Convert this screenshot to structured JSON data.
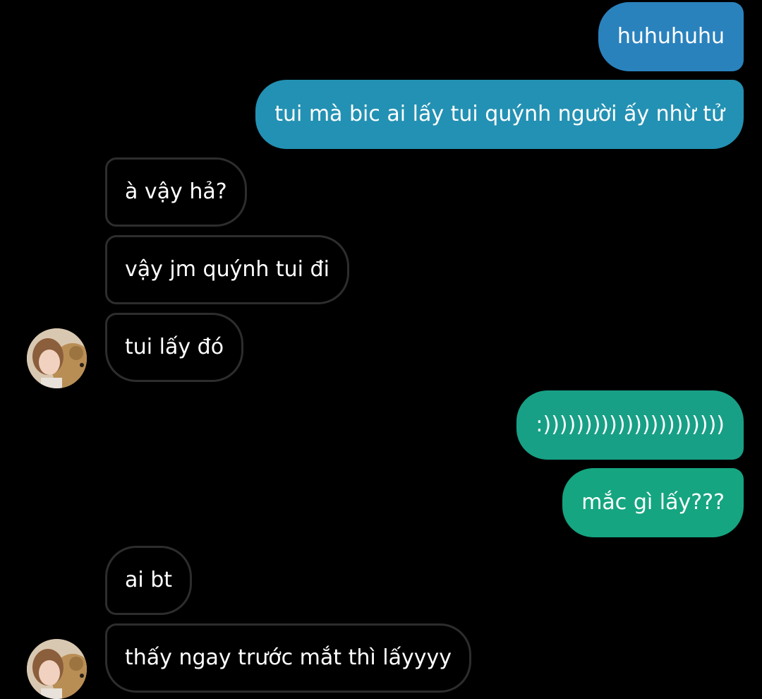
{
  "messages": [
    {
      "direction": "sent",
      "text": "huhuhuhu",
      "color": "#2a82bd"
    },
    {
      "direction": "sent",
      "text": "tui mà bic ai lấy tui quýnh người ấy nhừ tử",
      "color": "#2391b3"
    },
    {
      "direction": "received",
      "text": "à vậy hả?"
    },
    {
      "direction": "received",
      "text": "vậy jm quýnh tui đi"
    },
    {
      "direction": "received",
      "text": "tui lấy đó",
      "avatar": true
    },
    {
      "direction": "sent",
      "text": ":))))))))))))))))))))))",
      "color": "#18a086"
    },
    {
      "direction": "sent",
      "text": "mắc gì lấy???",
      "color": "#15a580"
    },
    {
      "direction": "received",
      "text": "ai bt"
    },
    {
      "direction": "received",
      "text": "thấy ngay trước mắt thì lấyyyy",
      "avatar": true
    }
  ],
  "theme": {
    "background": "#000000",
    "received_border": "#2d2d2d",
    "text_color": "#ffffff"
  }
}
